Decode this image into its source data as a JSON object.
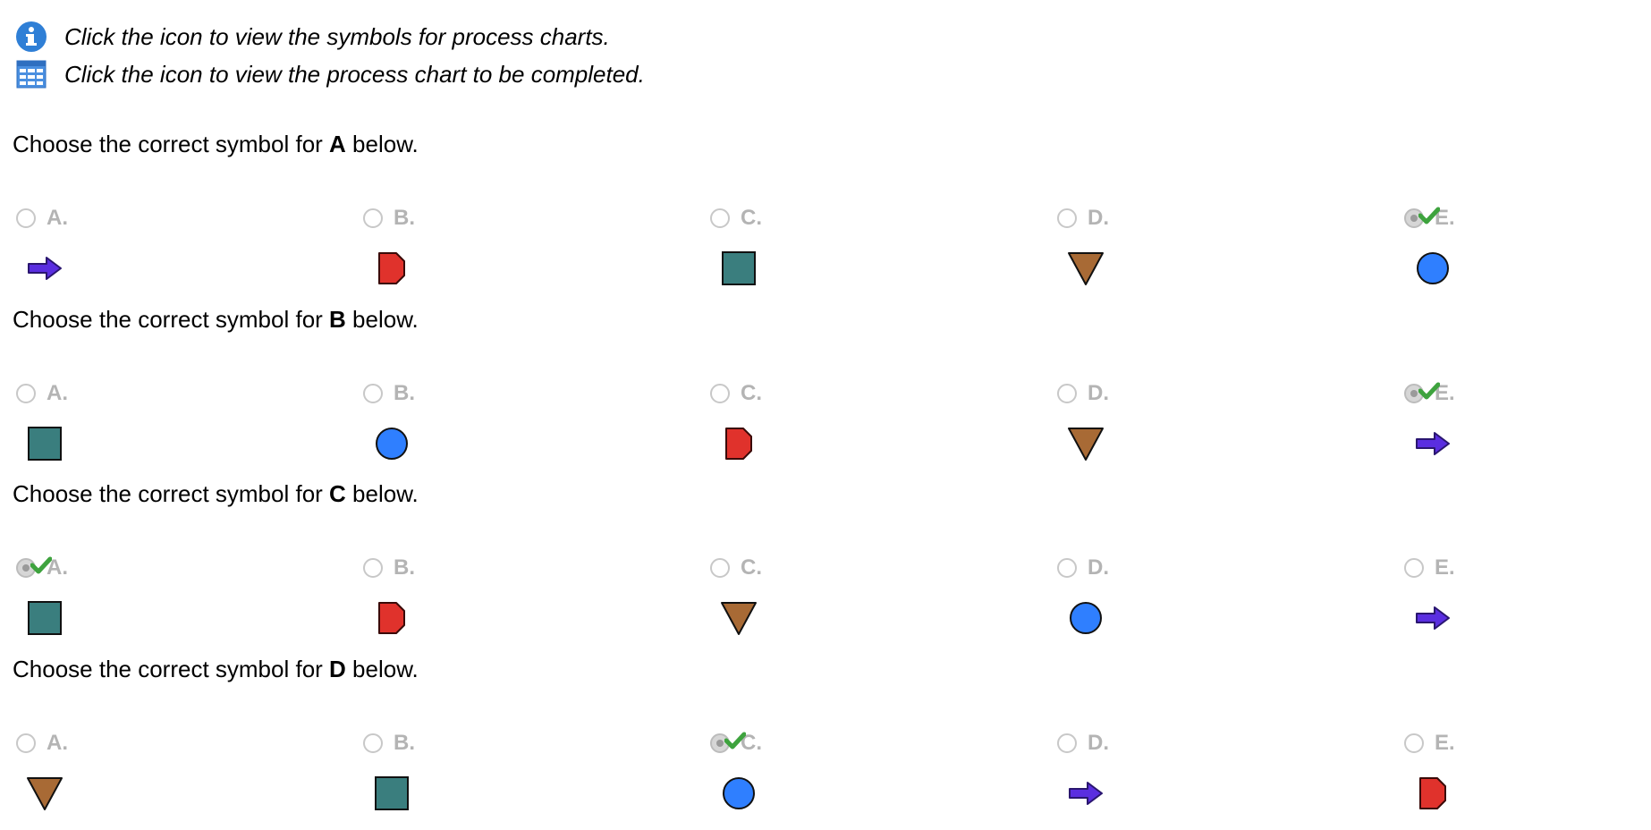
{
  "info": {
    "line1": "Click the icon to view the symbols for process charts.",
    "line2": "Click the icon to view the process chart to be completed."
  },
  "colors": {
    "info_blue": "#2f7fd6",
    "arrow": "#5a2ee0",
    "delay": "#e0322c",
    "inspection": "#3a7e7e",
    "storage": "#a86a35",
    "operation": "#2f7fff",
    "check": "#3ea33e"
  },
  "questions": [
    {
      "prefix": "Choose the correct symbol for ",
      "target": "A",
      "suffix": " below.",
      "options": [
        {
          "letter": "A.",
          "symbol": "arrow-icon",
          "selected": false
        },
        {
          "letter": "B.",
          "symbol": "delay-d-icon",
          "selected": false
        },
        {
          "letter": "C.",
          "symbol": "square-icon",
          "selected": false
        },
        {
          "letter": "D.",
          "symbol": "triangle-icon",
          "selected": false
        },
        {
          "letter": "E.",
          "symbol": "circle-icon",
          "selected": true
        }
      ]
    },
    {
      "prefix": "Choose the correct symbol for ",
      "target": "B",
      "suffix": " below.",
      "options": [
        {
          "letter": "A.",
          "symbol": "square-icon",
          "selected": false
        },
        {
          "letter": "B.",
          "symbol": "circle-icon",
          "selected": false
        },
        {
          "letter": "C.",
          "symbol": "delay-d-icon",
          "selected": false
        },
        {
          "letter": "D.",
          "symbol": "triangle-icon",
          "selected": false
        },
        {
          "letter": "E.",
          "symbol": "arrow-icon",
          "selected": true
        }
      ]
    },
    {
      "prefix": "Choose the correct symbol for ",
      "target": "C",
      "suffix": " below.",
      "options": [
        {
          "letter": "A.",
          "symbol": "square-icon",
          "selected": true
        },
        {
          "letter": "B.",
          "symbol": "delay-d-icon",
          "selected": false
        },
        {
          "letter": "C.",
          "symbol": "triangle-icon",
          "selected": false
        },
        {
          "letter": "D.",
          "symbol": "circle-icon",
          "selected": false
        },
        {
          "letter": "E.",
          "symbol": "arrow-icon",
          "selected": false
        }
      ]
    },
    {
      "prefix": "Choose the correct symbol for ",
      "target": "D",
      "suffix": " below.",
      "options": [
        {
          "letter": "A.",
          "symbol": "triangle-icon",
          "selected": false
        },
        {
          "letter": "B.",
          "symbol": "square-icon",
          "selected": false
        },
        {
          "letter": "C.",
          "symbol": "circle-icon",
          "selected": true
        },
        {
          "letter": "D.",
          "symbol": "arrow-icon",
          "selected": false
        },
        {
          "letter": "E.",
          "symbol": "delay-d-icon",
          "selected": false
        }
      ]
    }
  ]
}
